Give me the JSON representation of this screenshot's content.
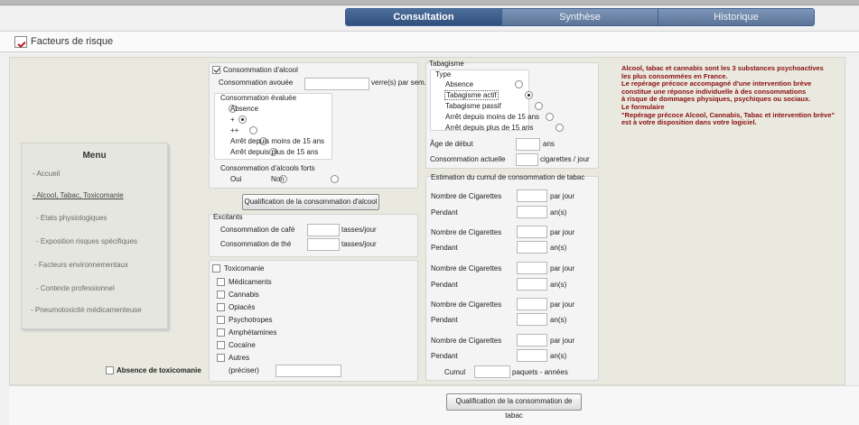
{
  "tabs": [
    "Consultation",
    "Synthèse",
    "Historique"
  ],
  "page_title": "Facteurs de risque",
  "menu": {
    "title": "Menu",
    "items": [
      "- Accueil",
      "- Alcool, Tabac, Toxicomanie",
      "- Etats physiologiques",
      "- Exposition risques spécifiques",
      "- Facteurs environnementaux",
      "- Contexte professionnel",
      "- Pneumotoxicité médicamenteuse"
    ]
  },
  "absence_toxicomanie": "Absence de toxicomanie",
  "alcool": {
    "checkbox": "Consommation d'alcool",
    "avouee_label": "Consommation avouée",
    "avouee_unit": "verre(s) par sem.",
    "evaluee_title": "Consommation évaluée",
    "evaluee_options": [
      "Absence",
      "+",
      "++",
      "Arrêt depuis moins de 15 ans",
      "Arrêt depuis plus de 15 ans"
    ],
    "forts_title": "Consommation d'alcools forts",
    "forts_options": [
      "Oui",
      "Non"
    ],
    "button": "Qualification de la consommation d'alcool"
  },
  "excitants": {
    "title": "Excitants",
    "cafe_label": "Consommation de café",
    "the_label": "Consommation de thé",
    "unit": "tasses/jour"
  },
  "toxicomanie": {
    "checkbox": "Toxicomanie",
    "items": [
      "Médicaments",
      "Cannabis",
      "Opiacés",
      "Psychotropes",
      "Amphétamines",
      "Cocaïne",
      "Autres"
    ],
    "preciser": "(préciser)"
  },
  "tabagisme": {
    "title": "Tabagisme",
    "type_title": "Type",
    "type_options": [
      "Absence",
      "Tabagisme actif",
      "Tabagisme passif",
      "Arrêt depuis moins de 15 ans",
      "Arrêt depuis plus de 15 ans"
    ],
    "age_label": "Âge de début",
    "age_unit": "ans",
    "actuelle_label": "Consommation actuelle",
    "actuelle_unit": "cigarettes / jour",
    "cumul_title": "Estimation du cumul de consommation de tabac",
    "nb_label": "Nombre de Cigarettes",
    "nb_unit": "par jour",
    "pendant_label": "Pendant",
    "pendant_unit": "an(s)",
    "cumul_label": "Cumul",
    "cumul_unit": "paquets - années",
    "button": "Qualification de la consommation de tabac"
  },
  "info_lines": [
    "Alcool, tabac et cannabis sont les 3 substances psychoactives",
    "les plus consommées en France.",
    "Le repérage précoce accompagné d'une intervention brève",
    "constitue une réponse individuelle à des consommations",
    "à risque de dommages physiques, psychiques ou sociaux.",
    "Le formulaire",
    "\"Repérage précoce Alcool, Cannabis, Tabac et intervention brève\"",
    "est à votre disposition dans votre logiciel."
  ]
}
